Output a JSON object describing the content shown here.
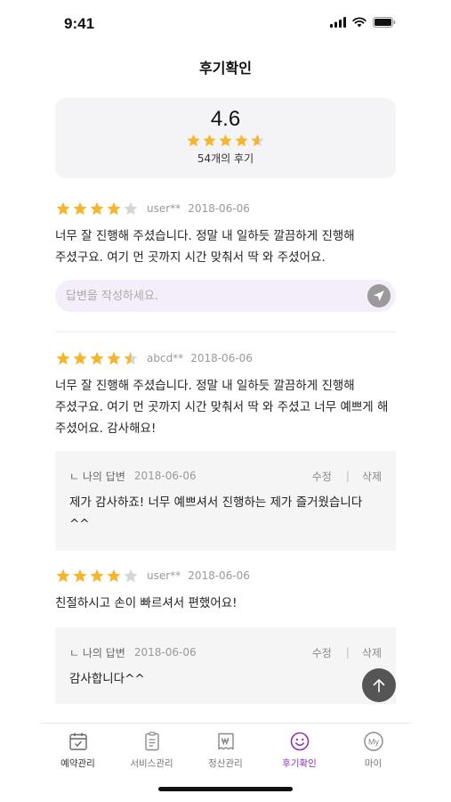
{
  "status_bar": {
    "time": "9:41"
  },
  "header": {
    "title": "후기확인"
  },
  "summary": {
    "score": "4.6",
    "rating": 4.6,
    "count_label": "54개의 후기"
  },
  "reviews": [
    {
      "rating": 4,
      "user": "user**",
      "date": "2018-06-06",
      "text": "너무 잘 진행해 주셨습니다. 정말 내 일하듯 깔끔하게 진행해 주셨구요. 여기 먼 곳까지 시간 맞춰서 딱 와 주셨어요."
    },
    {
      "rating": 4.5,
      "user": "abcd**",
      "date": "2018-06-06",
      "text": "너무 잘 진행해 주셨습니다. 정말 내 일하듯 깔끔하게 진행해 주셨구요. 여기 먼 곳까지 시간 맞춰서 딱 와 주셨고 너무 예쁘게 해 주셨어요. 감사해요!"
    },
    {
      "rating": 4,
      "user": "user**",
      "date": "2018-06-06",
      "text": "친절하시고 손이 빠르셔서 편했어요!"
    }
  ],
  "reply_input": {
    "placeholder": "답변을 작성하세요."
  },
  "replies": [
    {
      "label": "ㄴ 나의 답변",
      "date": "2018-06-06",
      "edit": "수정",
      "sep": "|",
      "delete": "삭제",
      "text": "제가 감사하죠! 너무 예쁘셔서 진행하는 제가 즐거웠습니다^^"
    },
    {
      "label": "ㄴ 나의 답변",
      "date": "2018-06-06",
      "edit": "수정",
      "sep": "|",
      "delete": "삭제",
      "text": "감사합니다^^"
    }
  ],
  "tabbar": [
    {
      "label": "예약관리",
      "icon": "calendar-check-icon"
    },
    {
      "label": "서비스관리",
      "icon": "clipboard-icon"
    },
    {
      "label": "정산관리",
      "icon": "won-receipt-icon"
    },
    {
      "label": "후기확인",
      "icon": "smile-icon",
      "active": true
    },
    {
      "label": "마이",
      "icon": "my-icon"
    }
  ],
  "colors": {
    "star": "#f7b52c",
    "star_empty": "#d6d6d6",
    "accent": "#8e2fbe",
    "reply_bg": "#f5f5f5",
    "input_bg": "#f4eefa"
  }
}
